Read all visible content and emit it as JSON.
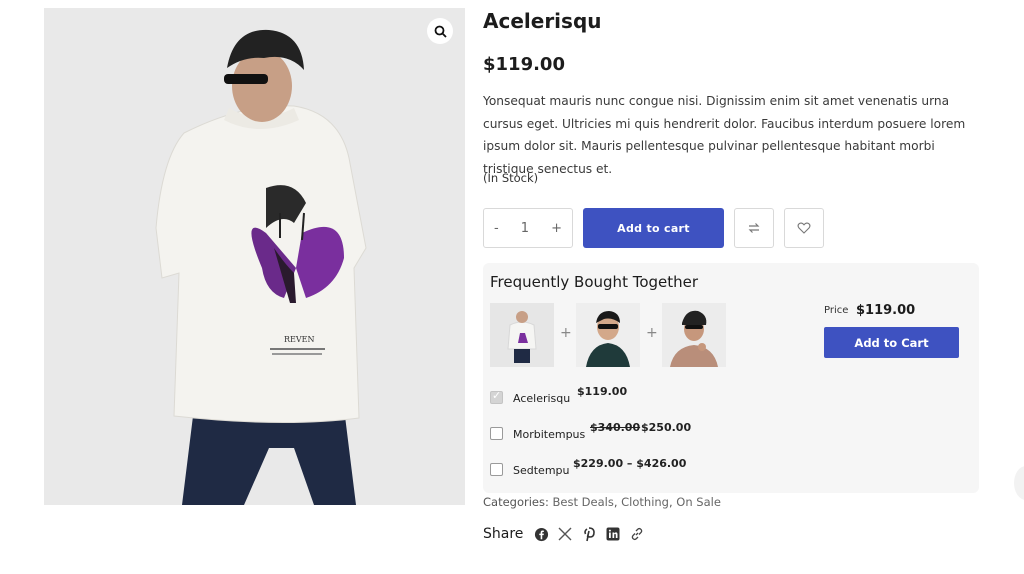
{
  "product": {
    "title": "Acelerisqu",
    "price": "$119.00",
    "description": "Yonsequat mauris nunc congue nisi. Dignissim enim sit amet venenatis urna cursus eget. Ultricies mi quis hendrerit dolor. Faucibus interdum posuere lorem ipsum dolor sit. Mauris pellentesque pulvinar pellentesque habitant morbi tristique senectus et.",
    "stock": "(In Stock)",
    "image_print_text": "REVEN"
  },
  "cart": {
    "minus": "-",
    "quantity": "1",
    "plus": "+",
    "add_label": "Add to cart"
  },
  "fbt": {
    "title": "Frequently Bought Together",
    "plus_sign": "+",
    "price_label": "Price",
    "total": "$119.00",
    "add_label": "Add to Cart",
    "items": [
      {
        "name": "Acelerisqu",
        "price": "$119.00",
        "checked": true
      },
      {
        "name": "Morbitempus",
        "old_price": "$340.00",
        "price": "$250.00",
        "checked": false
      },
      {
        "name": "Sedtempu",
        "price": "$229.00 – $426.00",
        "checked": false
      }
    ]
  },
  "categories": {
    "label": "Categories:",
    "items": [
      "Best Deals",
      "Clothing",
      "On Sale"
    ],
    "sep": ","
  },
  "share": {
    "label": "Share",
    "icons": [
      "facebook-icon",
      "x-icon",
      "pinterest-icon",
      "linkedin-icon",
      "link-icon"
    ]
  },
  "colors": {
    "accent": "#3e52c1",
    "gallery_bg": "#e9e9e9",
    "panel_bg": "#f6f6f6"
  }
}
